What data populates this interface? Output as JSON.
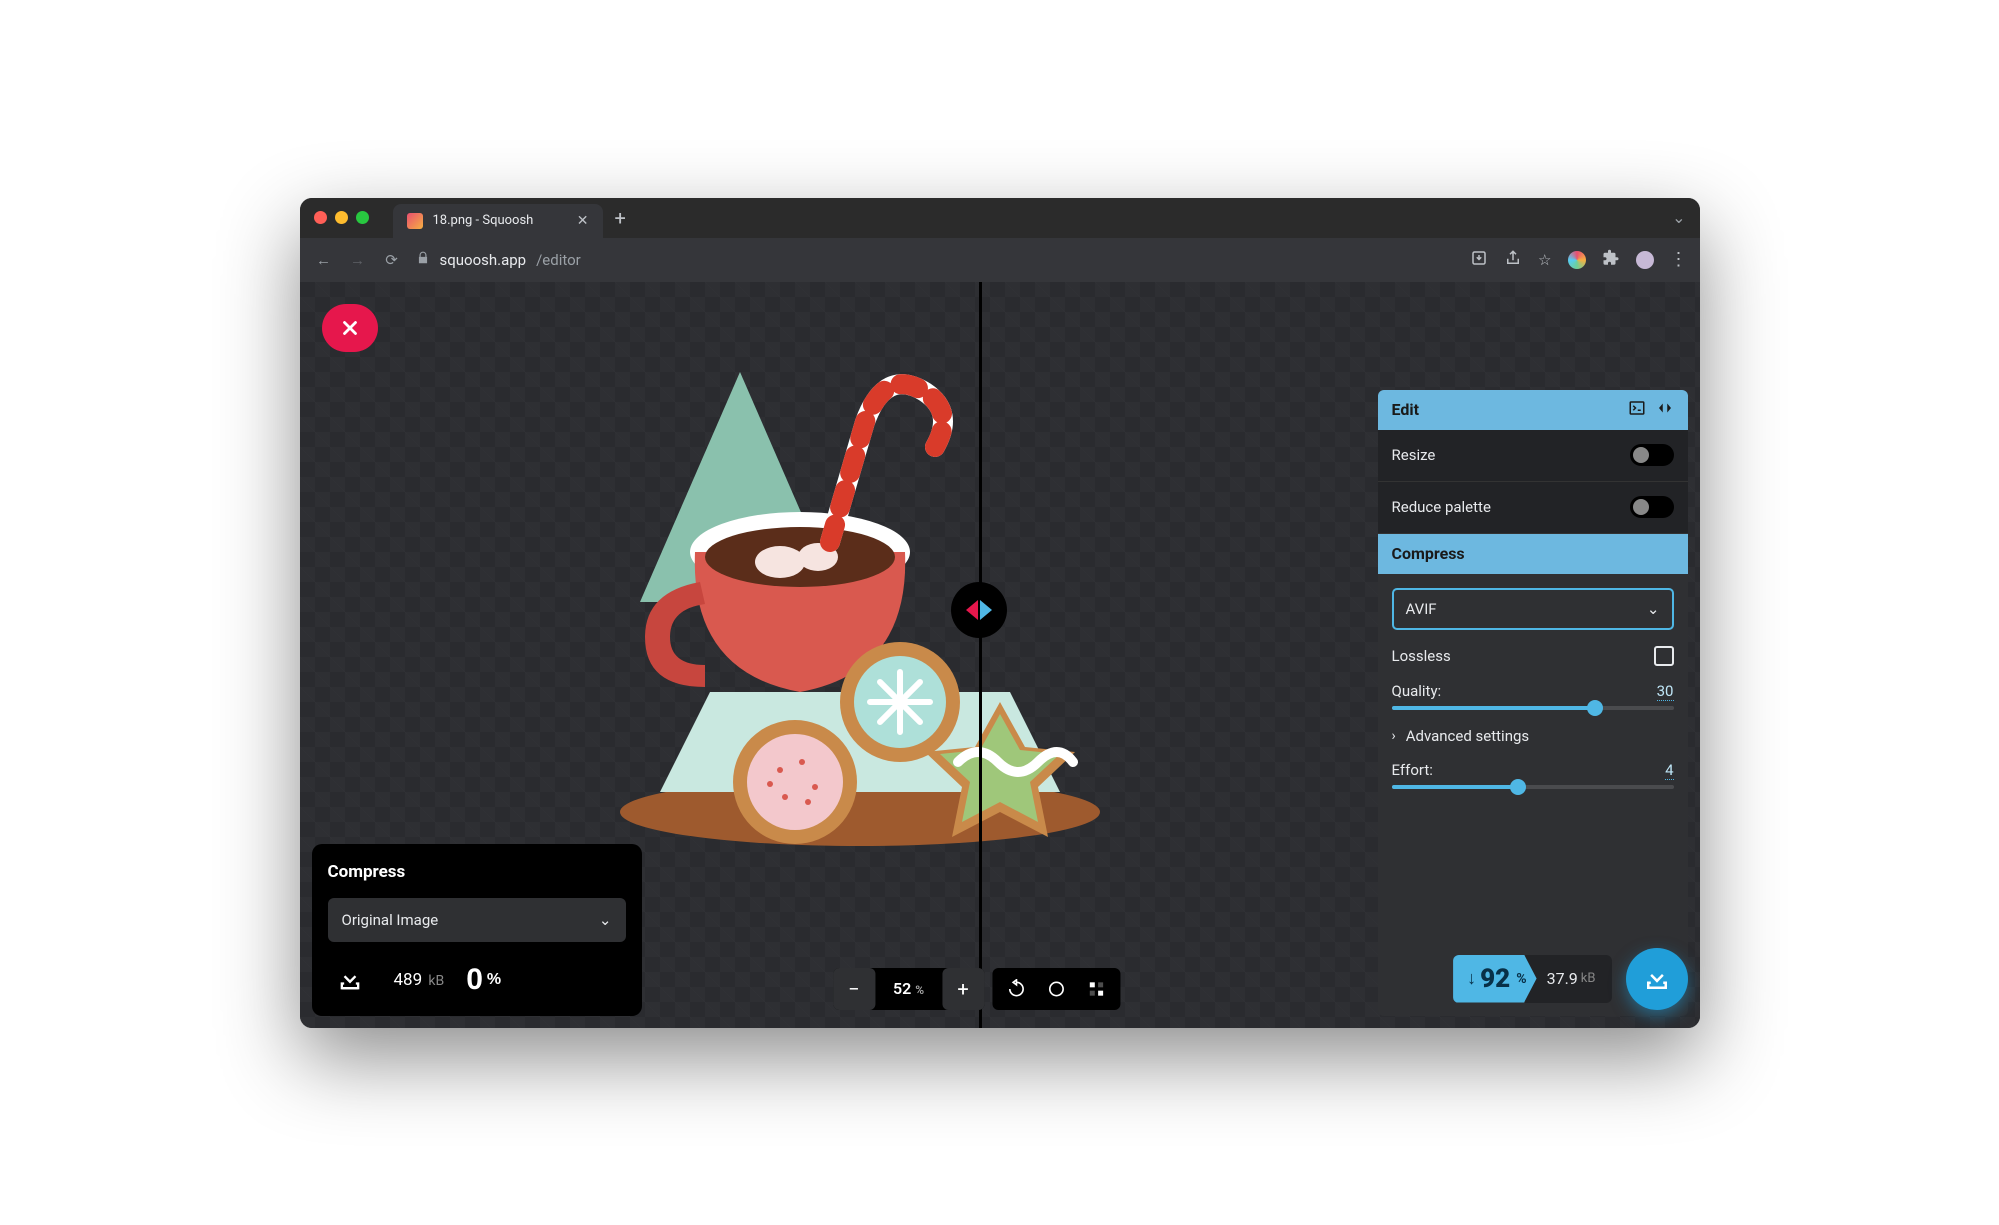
{
  "browser": {
    "tab_title": "18.png - Squoosh",
    "url_host": "squoosh.app",
    "url_path": "/editor"
  },
  "left_panel": {
    "title": "Compress",
    "source_select": "Original Image",
    "size_value": "489",
    "size_unit": "kB",
    "reduction_pct": "0"
  },
  "zoom": {
    "value": "52"
  },
  "right_panel": {
    "edit_title": "Edit",
    "resize_label": "Resize",
    "reduce_label": "Reduce palette",
    "compress_title": "Compress",
    "codec": "AVIF",
    "lossless_label": "Lossless",
    "quality_label": "Quality:",
    "quality_value": "30",
    "advanced_label": "Advanced settings",
    "effort_label": "Effort:",
    "effort_value": "4"
  },
  "right_stats": {
    "reduction_pct": "92",
    "size_value": "37.9",
    "size_unit": "kB"
  }
}
